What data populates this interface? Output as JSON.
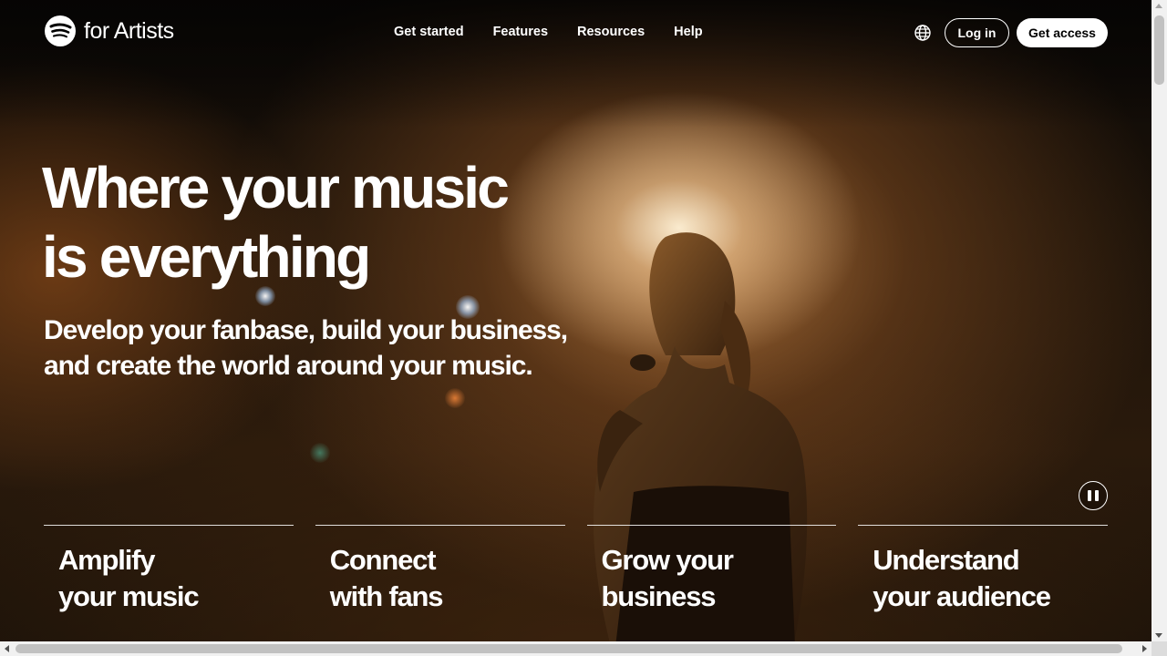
{
  "header": {
    "logo_text": "for Artists",
    "logo_icon": "spotify-icon",
    "nav": [
      {
        "label": "Get started"
      },
      {
        "label": "Features"
      },
      {
        "label": "Resources"
      },
      {
        "label": "Help"
      }
    ],
    "language_icon": "globe-icon",
    "login_label": "Log in",
    "access_label": "Get access"
  },
  "hero": {
    "title_line1": "Where your music",
    "title_line2": "is everything",
    "subtitle": "Develop your fanbase, build your business, and create the world around your music.",
    "pause_icon": "pause-icon"
  },
  "cards": [
    {
      "title": "Amplify\nyour music"
    },
    {
      "title": "Connect\nwith fans"
    },
    {
      "title": "Grow your\nbusiness"
    },
    {
      "title": "Understand\nyour audience"
    }
  ],
  "colors": {
    "text": "#ffffff",
    "button_primary_bg": "#ffffff",
    "button_primary_text": "#000000",
    "background": "#1a1108"
  }
}
